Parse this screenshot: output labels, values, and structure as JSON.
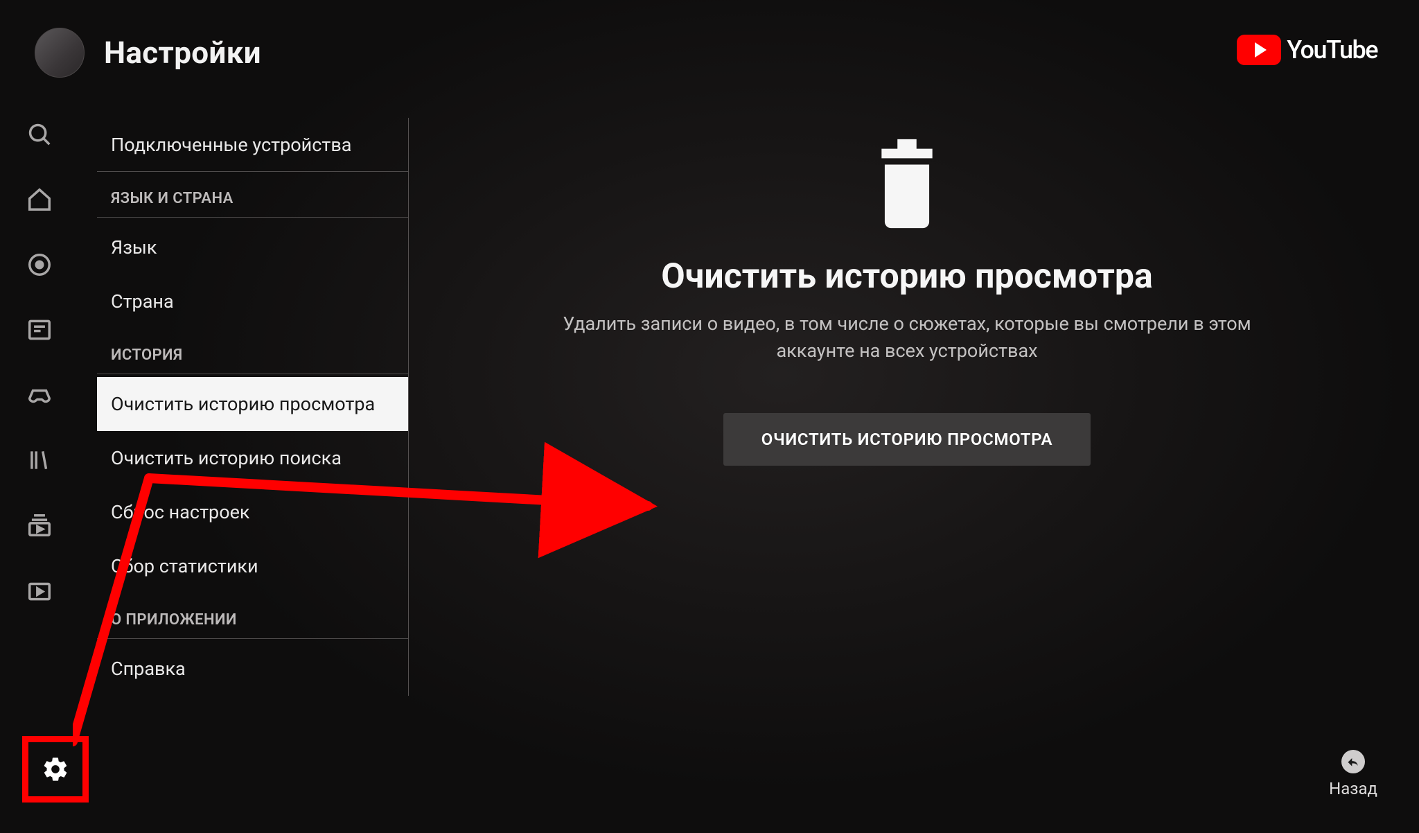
{
  "header": {
    "title": "Настройки"
  },
  "brand": {
    "name": "YouTube"
  },
  "sidebar": {
    "top_item": "Подключенные устройства",
    "sections": [
      {
        "header": "ЯЗЫК И СТРАНА",
        "items": [
          "Язык",
          "Страна"
        ]
      },
      {
        "header": "ИСТОРИЯ",
        "items": [
          "Очистить историю просмотра",
          "Очистить историю поиска",
          "Сброс настроек",
          "Сбор статистики"
        ]
      },
      {
        "header": "О ПРИЛОЖЕНИИ",
        "items": [
          "Справка"
        ]
      }
    ],
    "selected_item": "Очистить историю просмотра"
  },
  "nav_icons": [
    "search",
    "home",
    "record",
    "news",
    "gaming",
    "library",
    "subscriptions",
    "watch-later"
  ],
  "main": {
    "title": "Очистить историю просмотра",
    "description": "Удалить записи о видео, в том числе о сюжетах, которые вы смотрели в этом аккаунте на всех устройствах",
    "button": "ОЧИСТИТЬ ИСТОРИЮ ПРОСМОТРА"
  },
  "back": {
    "label": "Назад"
  },
  "annotation": {
    "highlight": "settings-gear",
    "arrow_from": "sidebar-clear-watch-history",
    "arrow_to": "clear-history-button",
    "color": "#ff0000"
  }
}
